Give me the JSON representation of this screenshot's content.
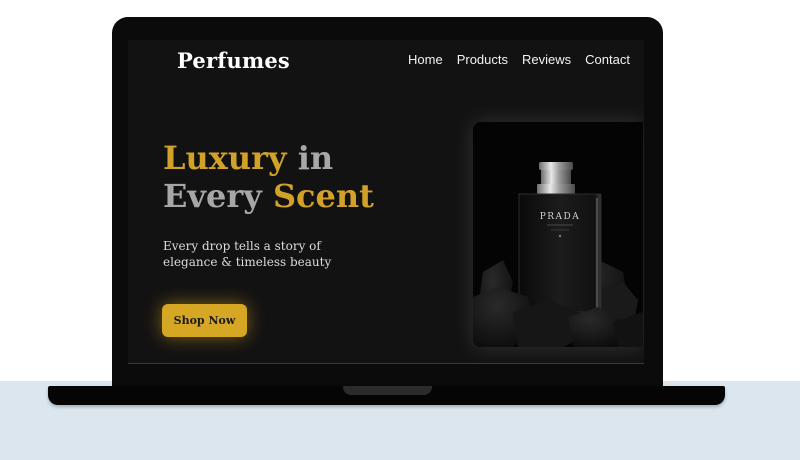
{
  "site": {
    "logo": "Perfumes",
    "nav": [
      "Home",
      "Products",
      "Reviews",
      "Contact"
    ]
  },
  "hero": {
    "title_line1_gold": "Luxury",
    "title_line1_gray": " in",
    "title_line2_gray": "Every ",
    "title_line2_gold": "Scent",
    "subtitle_line1": "Every drop tells a story of",
    "subtitle_line2": "elegance & timeless beauty",
    "cta_label": "Shop Now"
  },
  "product": {
    "brand_text": "PRADA"
  },
  "colors": {
    "accent_gold": "#d1a12a",
    "button_gold": "#d6a625",
    "background": "#121212",
    "desk": "#dbe6ef"
  }
}
